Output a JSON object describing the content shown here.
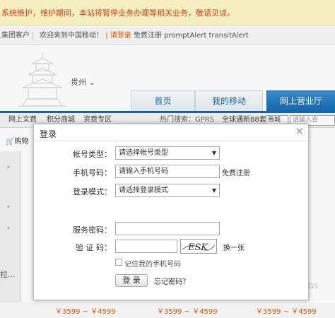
{
  "notice": {
    "text": "系统维护，维护期间，本站将暂停业务办理等相关业务，敬请见谅。"
  },
  "topbar": {
    "left": "集团客户",
    "welcome": "欢迎来到中国移动！",
    "login": "请登录",
    "register_text": "免费注册 promptAlert transitAlert"
  },
  "header": {
    "city": "贵州 ⌄"
  },
  "tabs": [
    {
      "label": "首页"
    },
    {
      "label": "我的移动"
    },
    {
      "label": "网上营业厅"
    }
  ],
  "navbar": {
    "items": [
      "网上文费",
      "积分商城",
      "资费专区"
    ],
    "hot_search": "热门搜索：GPRS",
    "hot_item": "全球通新88套餐",
    "select_value": "商城",
    "search_placeholder": "请输入查"
  },
  "cart": {
    "label": "购物"
  },
  "sidebar": {
    "arrow": "›",
    "partial_label": "拉..."
  },
  "prices": [
    "￥3599 ~ ￥4599",
    "￥3599 ~ ￥4599",
    "￥3599 ~ ￥4599"
  ],
  "background_text": {
    "gs": "GS"
  },
  "dialog": {
    "title": "登录",
    "close": "×",
    "account_type_label": "帐号类型：",
    "account_type_value": "请选择帐号类型",
    "phone_label": "手机号码：",
    "phone_placeholder": "请输入手机号码",
    "register_link": "免费注册",
    "login_mode_label": "登录模式：",
    "login_mode_value": "请选择登录模式",
    "service_password_label": "服务密码：",
    "captcha_label": "验 证 码：",
    "captcha_text": "ESK",
    "refresh_link": "换一张",
    "remember_label": "记住我的手机号码",
    "login_button": "登 录",
    "forgot_link": "忘记密码？"
  }
}
